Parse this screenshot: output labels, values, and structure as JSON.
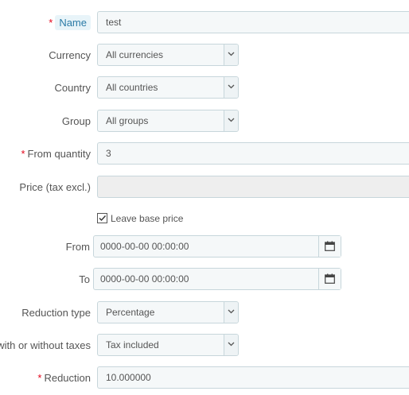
{
  "name": {
    "label": "Name",
    "required_mark": "*",
    "value": "test"
  },
  "currency": {
    "label": "Currency",
    "selected": "All currencies"
  },
  "country": {
    "label": "Country",
    "selected": "All countries"
  },
  "group": {
    "label": "Group",
    "selected": "All groups"
  },
  "from_quantity": {
    "label": "From quantity",
    "required_mark": "*",
    "value": "3"
  },
  "price": {
    "label": "Price (tax excl.)",
    "value": ""
  },
  "leave_base_price": {
    "label": "Leave base price",
    "checked": true
  },
  "from_date": {
    "label": "From",
    "value": "0000-00-00 00:00:00",
    "icon": "calendar-icon"
  },
  "to_date": {
    "label": "To",
    "value": "0000-00-00 00:00:00",
    "icon": "calendar-icon"
  },
  "reduction_type": {
    "label": "Reduction type",
    "selected": "Percentage"
  },
  "reduction_tax": {
    "label": "with or without taxes",
    "selected": "Tax included"
  },
  "reduction": {
    "label": "Reduction",
    "required_mark": "*",
    "value": "10.000000"
  },
  "colors": {
    "required": "#e3051b",
    "label_highlight_bg": "#e8f4f9",
    "label_highlight_text": "#2a7aa6",
    "field_bg": "#f5f8f9",
    "field_border": "#c7d6db",
    "disabled_bg": "#eeeeee"
  }
}
